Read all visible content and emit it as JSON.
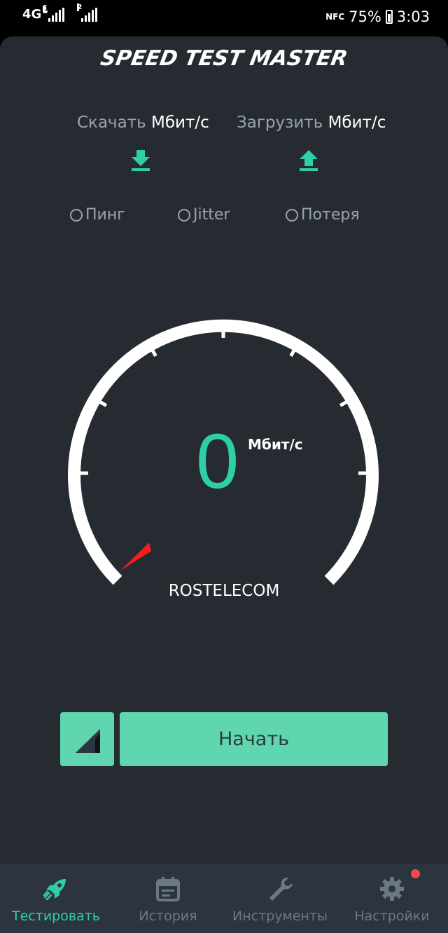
{
  "status_bar": {
    "network": "4G",
    "sim1_badge": "1",
    "sim2_badge": "2",
    "nfc": "NFC",
    "battery": "75%",
    "time": "3:03"
  },
  "app": {
    "logo": "SPEED TEST MASTER",
    "download": {
      "label": "Скачать",
      "unit": "Мбит/с"
    },
    "upload": {
      "label": "Загрузить",
      "unit": "Мбит/с"
    },
    "metrics": {
      "ping": "Пинг",
      "jitter": "Jitter",
      "loss": "Потеря"
    },
    "gauge": {
      "value": "0",
      "unit": "Мбит/с",
      "level": 0
    },
    "isp": "ROSTELECOM",
    "start_label": "Начать"
  },
  "nav": {
    "items": [
      {
        "label": "Тестировать",
        "icon": "rocket-icon",
        "active": true
      },
      {
        "label": "История",
        "icon": "calendar-icon",
        "active": false
      },
      {
        "label": "Инструменты",
        "icon": "wrench-icon",
        "active": false
      },
      {
        "label": "Настройки",
        "icon": "gear-icon",
        "active": false,
        "notification": true
      }
    ]
  },
  "colors": {
    "accent": "#2ecfa8",
    "button": "#5fd6b0",
    "panel": "#252b31",
    "needle": "#ff1a1a",
    "notification": "#f04a4a"
  }
}
